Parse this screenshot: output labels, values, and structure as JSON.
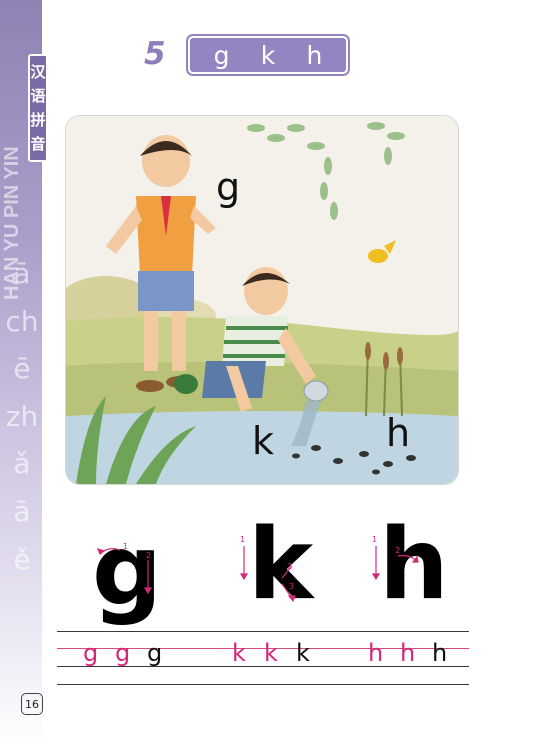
{
  "side_tab": {
    "label_chars": [
      "汉",
      "语",
      "拼",
      "音"
    ],
    "vertical_text": "HAN YU PIN YIN",
    "faded_letters": [
      "ā",
      "ch",
      "ē",
      "zh",
      "ǎ",
      "ā",
      "ě"
    ]
  },
  "header": {
    "lesson_number": "5",
    "letters": [
      "g",
      "k",
      "h"
    ]
  },
  "illustration": {
    "letters": [
      "g",
      "k",
      "h"
    ]
  },
  "writing": {
    "big_letters": [
      "g",
      "k",
      "h"
    ],
    "stroke_numbers": {
      "g": [
        "1",
        "2"
      ],
      "k": [
        "1",
        "2",
        "3"
      ],
      "h": [
        "1",
        "2"
      ]
    },
    "practice": {
      "g": [
        "g",
        "g",
        "g"
      ],
      "k": [
        "k",
        "k",
        "k"
      ],
      "h": [
        "h",
        "h",
        "h"
      ]
    }
  },
  "page_number": "16",
  "colors": {
    "accent_purple": "#9484c2",
    "stroke_pink": "#d4287a"
  }
}
